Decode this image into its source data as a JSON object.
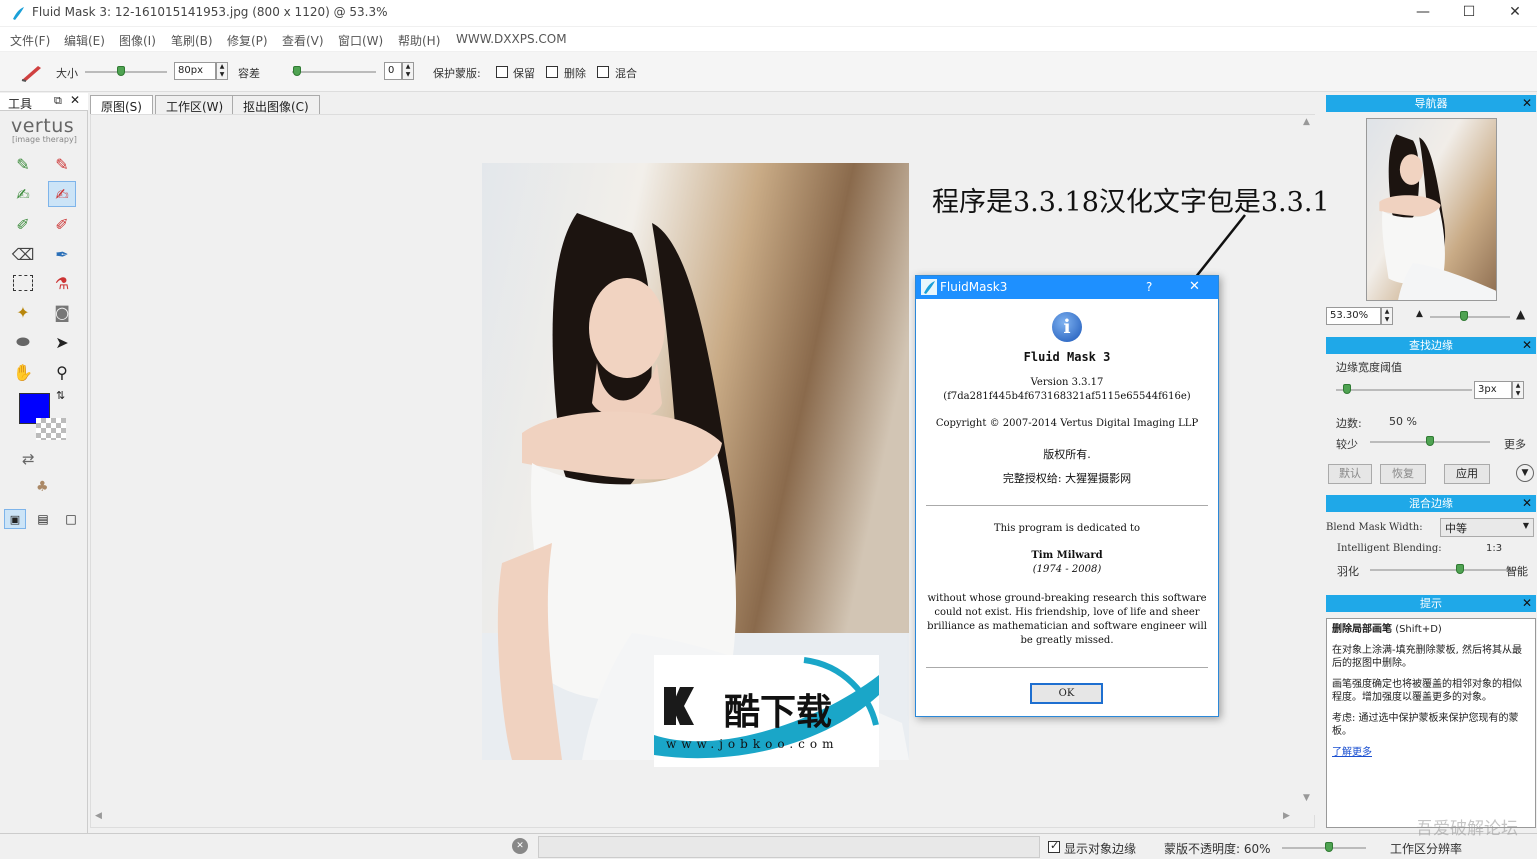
{
  "window": {
    "title": "Fluid Mask 3: 12-161015141953.jpg (800 x 1120) @ 53.3%"
  },
  "menu": [
    "文件(F)",
    "编辑(E)",
    "图像(I)",
    "笔刷(B)",
    "修复(P)",
    "查看(V)",
    "窗口(W)",
    "帮助(H)",
    "WWW.DXXPS.COM"
  ],
  "toolbar": {
    "size_label": "大小",
    "size_value": "80px",
    "tolerance_label": "容差",
    "tolerance_value": "0",
    "protect_label": "保护蒙版:",
    "keep_label": "保留",
    "delete_label": "删除",
    "mix_label": "混合"
  },
  "tools_panel": {
    "title": "工具",
    "logo": "vertus",
    "logo_sub": "[image therapy]",
    "fg_color": "#0000ff"
  },
  "tabs": [
    "原图(S)",
    "工作区(W)",
    "抠出图像(C)"
  ],
  "annotation": "程序是3.3.18汉化文字包是3.3.17",
  "dialog": {
    "title": "FluidMask3",
    "help": "?",
    "app_name": "Fluid  Mask  3",
    "version": "Version 3.3.17",
    "hash": "(f7da281f445b4f673168321af5115e65544f616e)",
    "copyright": "Copyright © 2007-2014 Vertus Digital Imaging LLP",
    "rights": "版权所有.",
    "licensed": "完整授权给: 大猩猩摄影网",
    "dedicated": "This program is dedicated to",
    "person": "Tim Milward",
    "years": "(1974  -  2008)",
    "tribute": "without whose ground-breaking research this software could not exist. His friendship, love of life and sheer brilliance as mathematician and software engineer will be greatly missed.",
    "ok": "OK"
  },
  "watermark": {
    "brand": "酷下载",
    "url": "www.jobkoo.com"
  },
  "navigator": {
    "title": "导航器",
    "zoom": "53.30%"
  },
  "edges": {
    "title": "查找边缘",
    "threshold_label": "边缘宽度阈值",
    "threshold_value": "3px",
    "count_label": "边数:",
    "count_value": "50 %",
    "less": "较少",
    "more": "更多",
    "default_btn": "默认",
    "restore_btn": "恢复",
    "apply_btn": "应用"
  },
  "blend": {
    "title": "混合边缘",
    "mask_width_label": "Blend Mask Width:",
    "mask_width_value": "中等",
    "intelligent_label": "Intelligent Blending:",
    "intelligent_value": "1:3",
    "feather": "羽化",
    "smart": "智能"
  },
  "hints": {
    "title": "提示",
    "heading": "删除局部画笔",
    "shortcut": "(Shift+D)",
    "p1": "在对象上涂满-填充删除蒙板, 然后将其从最后的抠图中删除。",
    "p2": "画笔强度确定也将被覆盖的相邻对象的相似程度。增加强度以覆盖更多的对象。",
    "p3": "考虑: 通过选中保护蒙板来保护您现有的蒙板。",
    "link": "了解更多"
  },
  "status": {
    "show_edges": "显示对象边缘",
    "opacity": "蒙版不透明度: 60%",
    "workspace": "工作区分辨率",
    "forum": "吾爱破解论坛"
  }
}
